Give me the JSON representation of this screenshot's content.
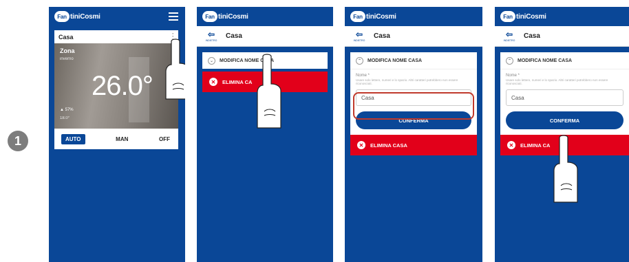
{
  "step_number": "1",
  "brand": {
    "mark": "Fan",
    "name": "tiniCosmi"
  },
  "icons": {
    "back": "back-door-icon",
    "hamburger": "hamburger-icon",
    "kebab": "kebab-icon",
    "chevron": "chevron-circle-icon",
    "delete": "x-circle-icon",
    "hand": "hand-pointer-icon"
  },
  "colors": {
    "primary": "#0a4797",
    "danger": "#e2001a",
    "highlight": "#c0392b"
  },
  "screen1": {
    "house_name": "Casa",
    "zone_name": "Zona",
    "season": "inverno",
    "temperature": "26.0°",
    "humidity": "57%",
    "setpoint": "18.0°",
    "modes": [
      "AUTO",
      "MAN",
      "OFF"
    ],
    "active_mode": "AUTO"
  },
  "screen2": {
    "back_caption": "INDIETRO",
    "house_title": "Casa",
    "edit_label": "MODIFICA NOME CASA",
    "delete_label": "ELIMINA CA"
  },
  "screen3": {
    "back_caption": "INDIETRO",
    "house_title": "Casa",
    "edit_label": "MODIFICA NOME CASA",
    "field_label": "Nome *",
    "field_help": "Usare solo lettere, numeri e lo spazio. Altri caratteri potrebbero non essere riconosciuti.",
    "field_value": "Casa",
    "confirm_label": "CONFERMA",
    "delete_label": "ELIMINA CASA"
  },
  "screen4": {
    "back_caption": "INDIETRO",
    "house_title": "Casa",
    "edit_label": "MODIFICA NOME CASA",
    "field_label": "Nome *",
    "field_help": "Usare solo lettere, numeri e lo spazio. Altri caratteri potrebbero non essere riconosciuti.",
    "field_value": "Casa",
    "confirm_label": "CONFERMA",
    "delete_label": "ELIMINA CA"
  }
}
